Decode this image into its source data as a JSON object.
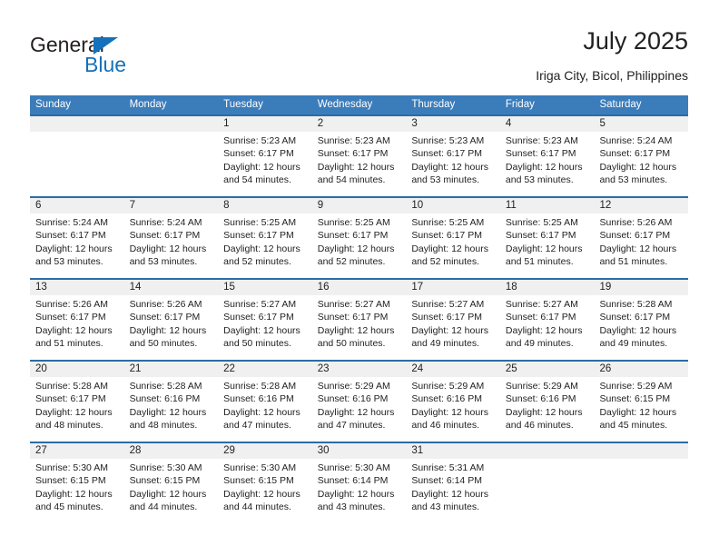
{
  "brand": {
    "name_part1": "General",
    "name_part2": "Blue",
    "triangle_color": "#1471bb"
  },
  "header": {
    "title": "July 2025",
    "subtitle": "Iriga City, Bicol, Philippines"
  },
  "theme": {
    "header_bg": "#3b7cba",
    "row_divider": "#2b6ca8",
    "date_band_bg": "#f0f0f0",
    "text": "#222222"
  },
  "calendar": {
    "weekdays": [
      "Sunday",
      "Monday",
      "Tuesday",
      "Wednesday",
      "Thursday",
      "Friday",
      "Saturday"
    ],
    "weeks": [
      [
        {
          "day": "",
          "l1": "",
          "l2": "",
          "l3": "",
          "l4": ""
        },
        {
          "day": "",
          "l1": "",
          "l2": "",
          "l3": "",
          "l4": ""
        },
        {
          "day": "1",
          "l1": "Sunrise: 5:23 AM",
          "l2": "Sunset: 6:17 PM",
          "l3": "Daylight: 12 hours",
          "l4": "and 54 minutes."
        },
        {
          "day": "2",
          "l1": "Sunrise: 5:23 AM",
          "l2": "Sunset: 6:17 PM",
          "l3": "Daylight: 12 hours",
          "l4": "and 54 minutes."
        },
        {
          "day": "3",
          "l1": "Sunrise: 5:23 AM",
          "l2": "Sunset: 6:17 PM",
          "l3": "Daylight: 12 hours",
          "l4": "and 53 minutes."
        },
        {
          "day": "4",
          "l1": "Sunrise: 5:23 AM",
          "l2": "Sunset: 6:17 PM",
          "l3": "Daylight: 12 hours",
          "l4": "and 53 minutes."
        },
        {
          "day": "5",
          "l1": "Sunrise: 5:24 AM",
          "l2": "Sunset: 6:17 PM",
          "l3": "Daylight: 12 hours",
          "l4": "and 53 minutes."
        }
      ],
      [
        {
          "day": "6",
          "l1": "Sunrise: 5:24 AM",
          "l2": "Sunset: 6:17 PM",
          "l3": "Daylight: 12 hours",
          "l4": "and 53 minutes."
        },
        {
          "day": "7",
          "l1": "Sunrise: 5:24 AM",
          "l2": "Sunset: 6:17 PM",
          "l3": "Daylight: 12 hours",
          "l4": "and 53 minutes."
        },
        {
          "day": "8",
          "l1": "Sunrise: 5:25 AM",
          "l2": "Sunset: 6:17 PM",
          "l3": "Daylight: 12 hours",
          "l4": "and 52 minutes."
        },
        {
          "day": "9",
          "l1": "Sunrise: 5:25 AM",
          "l2": "Sunset: 6:17 PM",
          "l3": "Daylight: 12 hours",
          "l4": "and 52 minutes."
        },
        {
          "day": "10",
          "l1": "Sunrise: 5:25 AM",
          "l2": "Sunset: 6:17 PM",
          "l3": "Daylight: 12 hours",
          "l4": "and 52 minutes."
        },
        {
          "day": "11",
          "l1": "Sunrise: 5:25 AM",
          "l2": "Sunset: 6:17 PM",
          "l3": "Daylight: 12 hours",
          "l4": "and 51 minutes."
        },
        {
          "day": "12",
          "l1": "Sunrise: 5:26 AM",
          "l2": "Sunset: 6:17 PM",
          "l3": "Daylight: 12 hours",
          "l4": "and 51 minutes."
        }
      ],
      [
        {
          "day": "13",
          "l1": "Sunrise: 5:26 AM",
          "l2": "Sunset: 6:17 PM",
          "l3": "Daylight: 12 hours",
          "l4": "and 51 minutes."
        },
        {
          "day": "14",
          "l1": "Sunrise: 5:26 AM",
          "l2": "Sunset: 6:17 PM",
          "l3": "Daylight: 12 hours",
          "l4": "and 50 minutes."
        },
        {
          "day": "15",
          "l1": "Sunrise: 5:27 AM",
          "l2": "Sunset: 6:17 PM",
          "l3": "Daylight: 12 hours",
          "l4": "and 50 minutes."
        },
        {
          "day": "16",
          "l1": "Sunrise: 5:27 AM",
          "l2": "Sunset: 6:17 PM",
          "l3": "Daylight: 12 hours",
          "l4": "and 50 minutes."
        },
        {
          "day": "17",
          "l1": "Sunrise: 5:27 AM",
          "l2": "Sunset: 6:17 PM",
          "l3": "Daylight: 12 hours",
          "l4": "and 49 minutes."
        },
        {
          "day": "18",
          "l1": "Sunrise: 5:27 AM",
          "l2": "Sunset: 6:17 PM",
          "l3": "Daylight: 12 hours",
          "l4": "and 49 minutes."
        },
        {
          "day": "19",
          "l1": "Sunrise: 5:28 AM",
          "l2": "Sunset: 6:17 PM",
          "l3": "Daylight: 12 hours",
          "l4": "and 49 minutes."
        }
      ],
      [
        {
          "day": "20",
          "l1": "Sunrise: 5:28 AM",
          "l2": "Sunset: 6:17 PM",
          "l3": "Daylight: 12 hours",
          "l4": "and 48 minutes."
        },
        {
          "day": "21",
          "l1": "Sunrise: 5:28 AM",
          "l2": "Sunset: 6:16 PM",
          "l3": "Daylight: 12 hours",
          "l4": "and 48 minutes."
        },
        {
          "day": "22",
          "l1": "Sunrise: 5:28 AM",
          "l2": "Sunset: 6:16 PM",
          "l3": "Daylight: 12 hours",
          "l4": "and 47 minutes."
        },
        {
          "day": "23",
          "l1": "Sunrise: 5:29 AM",
          "l2": "Sunset: 6:16 PM",
          "l3": "Daylight: 12 hours",
          "l4": "and 47 minutes."
        },
        {
          "day": "24",
          "l1": "Sunrise: 5:29 AM",
          "l2": "Sunset: 6:16 PM",
          "l3": "Daylight: 12 hours",
          "l4": "and 46 minutes."
        },
        {
          "day": "25",
          "l1": "Sunrise: 5:29 AM",
          "l2": "Sunset: 6:16 PM",
          "l3": "Daylight: 12 hours",
          "l4": "and 46 minutes."
        },
        {
          "day": "26",
          "l1": "Sunrise: 5:29 AM",
          "l2": "Sunset: 6:15 PM",
          "l3": "Daylight: 12 hours",
          "l4": "and 45 minutes."
        }
      ],
      [
        {
          "day": "27",
          "l1": "Sunrise: 5:30 AM",
          "l2": "Sunset: 6:15 PM",
          "l3": "Daylight: 12 hours",
          "l4": "and 45 minutes."
        },
        {
          "day": "28",
          "l1": "Sunrise: 5:30 AM",
          "l2": "Sunset: 6:15 PM",
          "l3": "Daylight: 12 hours",
          "l4": "and 44 minutes."
        },
        {
          "day": "29",
          "l1": "Sunrise: 5:30 AM",
          "l2": "Sunset: 6:15 PM",
          "l3": "Daylight: 12 hours",
          "l4": "and 44 minutes."
        },
        {
          "day": "30",
          "l1": "Sunrise: 5:30 AM",
          "l2": "Sunset: 6:14 PM",
          "l3": "Daylight: 12 hours",
          "l4": "and 43 minutes."
        },
        {
          "day": "31",
          "l1": "Sunrise: 5:31 AM",
          "l2": "Sunset: 6:14 PM",
          "l3": "Daylight: 12 hours",
          "l4": "and 43 minutes."
        },
        {
          "day": "",
          "l1": "",
          "l2": "",
          "l3": "",
          "l4": ""
        },
        {
          "day": "",
          "l1": "",
          "l2": "",
          "l3": "",
          "l4": ""
        }
      ]
    ]
  }
}
